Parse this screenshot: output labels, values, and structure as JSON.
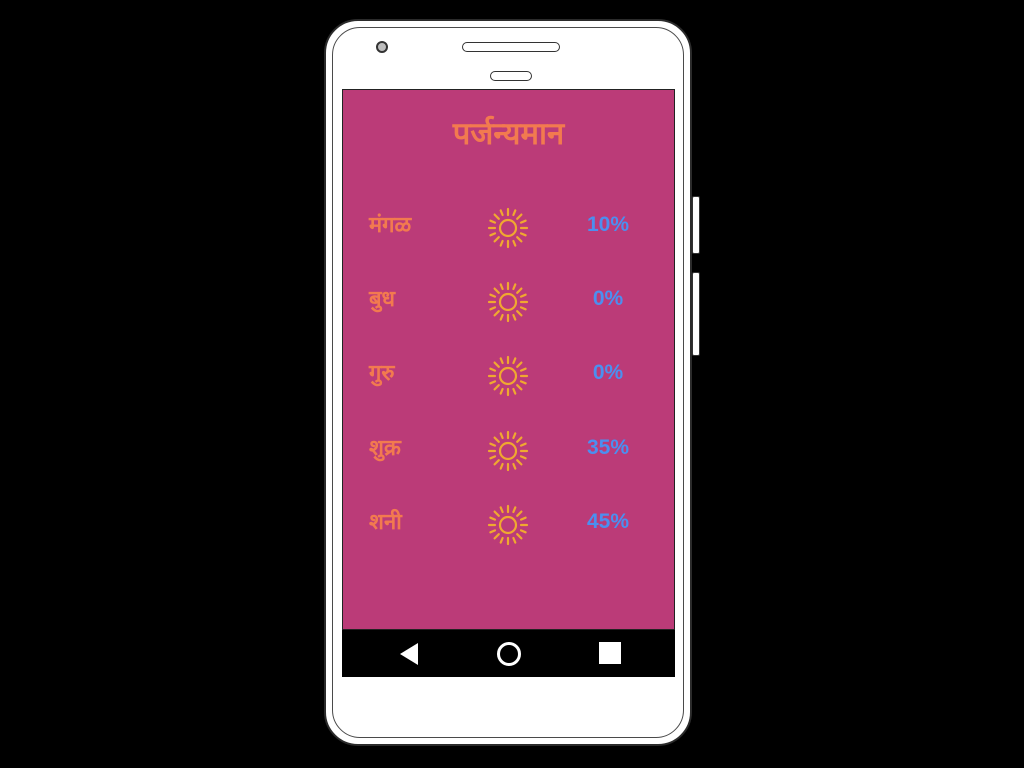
{
  "app": {
    "title": "पर्जन्यमान"
  },
  "forecast": [
    {
      "day": "मंगळ",
      "icon": "sun-icon",
      "chance": "10%"
    },
    {
      "day": "बुध",
      "icon": "sun-icon",
      "chance": "0%"
    },
    {
      "day": "गुरु",
      "icon": "sun-icon",
      "chance": "0%"
    },
    {
      "day": "शुक्र",
      "icon": "sun-icon",
      "chance": "35%"
    },
    {
      "day": "शनी",
      "icon": "sun-icon",
      "chance": "45%"
    }
  ],
  "navigation": {
    "back_icon": "back-triangle-icon",
    "home_icon": "home-circle-icon",
    "recents_icon": "recents-square-icon"
  },
  "colors": {
    "screen_background": "#bb3b78",
    "title_text": "#f27a4f",
    "day_text": "#f27a4f",
    "sun_icon": "#f0a830",
    "percent_text": "#4b8ff0",
    "nav_background": "#000000"
  }
}
